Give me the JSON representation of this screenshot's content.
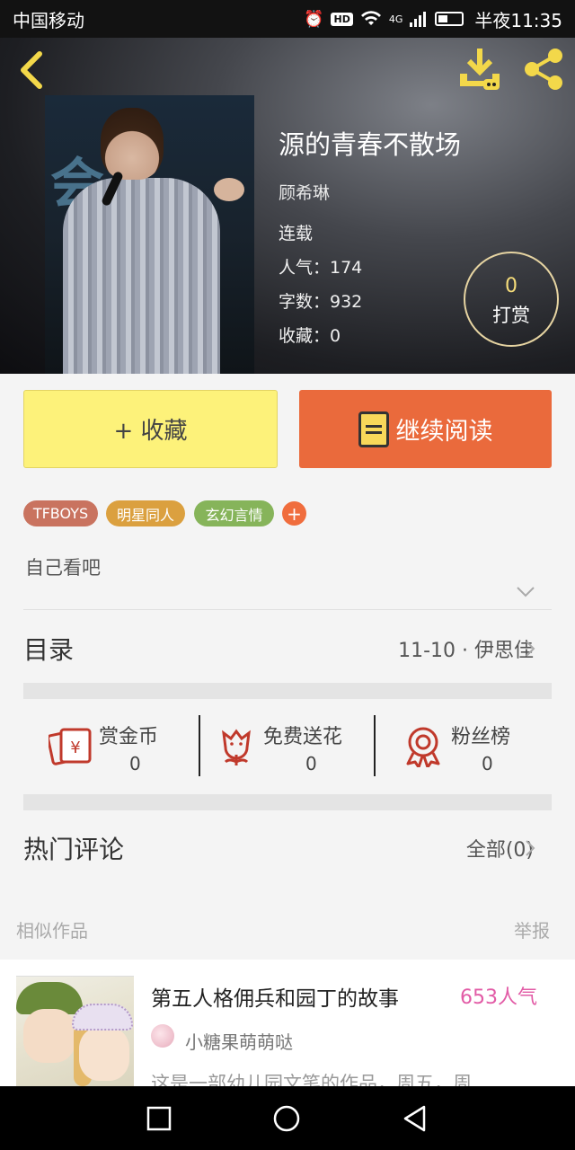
{
  "status_bar": {
    "carrier": "中国移动",
    "hd": "HD",
    "network": "4G",
    "time": "半夜11:35"
  },
  "book": {
    "title": "源的青春不散场",
    "author": "顾希琳",
    "status": "连载",
    "popularity": "人气：174",
    "word_count": "字数：932",
    "favorites": "收藏：0"
  },
  "tip": {
    "count": "0",
    "label": "打赏"
  },
  "actions": {
    "favorite": "+ 收藏",
    "continue_reading": "继续阅读"
  },
  "tags": [
    {
      "label": "TFBOYS",
      "color": "#c9735f"
    },
    {
      "label": "明星同人",
      "color": "#dba03f"
    },
    {
      "label": "玄幻言情",
      "color": "#86b45a"
    }
  ],
  "tag_add": "+",
  "intro": "自己看吧",
  "toc": {
    "label": "目录",
    "latest": "11-10 · 伊思佳"
  },
  "stats": [
    {
      "label": "赏金币",
      "value": "0"
    },
    {
      "label": "免费送花",
      "value": "0"
    },
    {
      "label": "粉丝榜",
      "value": "0"
    }
  ],
  "comments": {
    "label": "热门评论",
    "all": "全部(0)"
  },
  "similar": {
    "label": "相似作品",
    "report": "举报"
  },
  "card": {
    "title": "第五人格佣兵和园丁的故事",
    "popularity": "653人气",
    "author": "小糖果萌萌哒",
    "description": "这是一部幼儿园文笔的作品，周五，周"
  },
  "colors": {
    "accent_orange": "#ea6a3c",
    "accent_yellow": "#fdf27a",
    "icon_gold": "#f3d84a",
    "icon_red": "#c0392b"
  }
}
